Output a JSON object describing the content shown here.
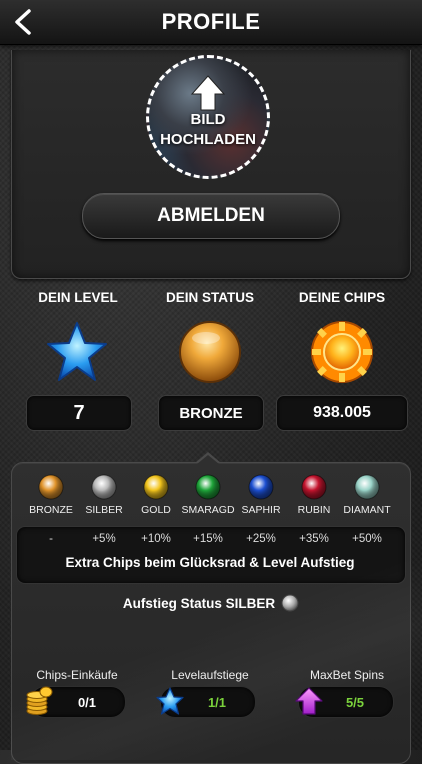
{
  "header": {
    "title": "PROFILE"
  },
  "profile": {
    "upload_line1": "BILD",
    "upload_line2": "HOCHLADEN",
    "logout_label": "ABMELDEN"
  },
  "stats": {
    "level_label": "DEIN LEVEL",
    "level_value": "7",
    "status_label": "DEIN STATUS",
    "status_value": "BRONZE",
    "chips_label": "DEINE CHIPS",
    "chips_value": "938.005"
  },
  "tiers": [
    {
      "name": "BRONZE",
      "bonus": "-",
      "color": "#e0932a"
    },
    {
      "name": "SILBER",
      "bonus": "+5%",
      "color": "#b9b9b9"
    },
    {
      "name": "GOLD",
      "bonus": "+10%",
      "color": "#f2c41c"
    },
    {
      "name": "SMARAGD",
      "bonus": "+15%",
      "color": "#1fa53a"
    },
    {
      "name": "SAPHIR",
      "bonus": "+25%",
      "color": "#1c4fd1"
    },
    {
      "name": "RUBIN",
      "bonus": "+35%",
      "color": "#c4142e"
    },
    {
      "name": "DIAMANT",
      "bonus": "+50%",
      "color": "#9ad3c8"
    }
  ],
  "bonus_text": "Extra Chips beim Glücksrad & Level Aufstieg",
  "ascend": {
    "text": "Aufstieg Status SILBER",
    "icon": "silver-gem-icon"
  },
  "progress": [
    {
      "label": "Chips-Einkäufe",
      "value": "0/1",
      "icon": "coin-stack-icon",
      "value_color": "#ffffff"
    },
    {
      "label": "Levelaufstiege",
      "value": "1/1",
      "icon": "blue-star-icon",
      "value_color": "#7bd23c"
    },
    {
      "label": "MaxBet Spins",
      "value": "5/5",
      "icon": "purple-arrow-icon",
      "value_color": "#7bd23c"
    }
  ]
}
